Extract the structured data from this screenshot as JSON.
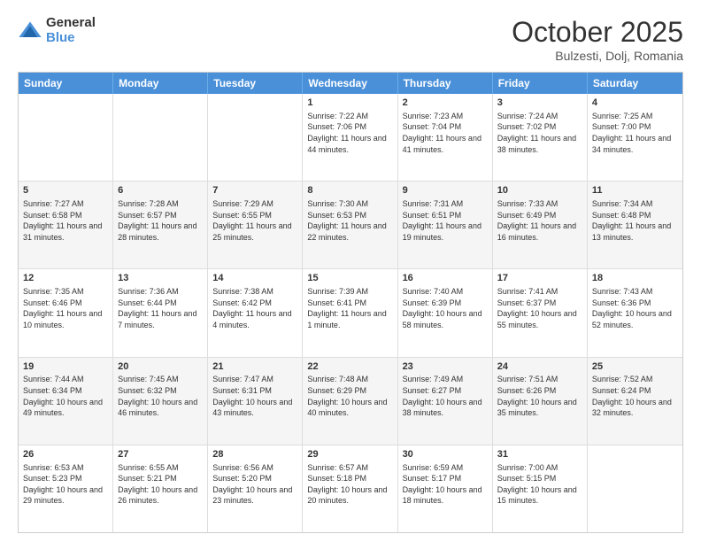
{
  "logo": {
    "general": "General",
    "blue": "Blue"
  },
  "header": {
    "month": "October 2025",
    "location": "Bulzesti, Dolj, Romania"
  },
  "weekdays": [
    "Sunday",
    "Monday",
    "Tuesday",
    "Wednesday",
    "Thursday",
    "Friday",
    "Saturday"
  ],
  "rows": [
    [
      {
        "day": "",
        "info": ""
      },
      {
        "day": "",
        "info": ""
      },
      {
        "day": "",
        "info": ""
      },
      {
        "day": "1",
        "info": "Sunrise: 7:22 AM\nSunset: 7:06 PM\nDaylight: 11 hours and 44 minutes."
      },
      {
        "day": "2",
        "info": "Sunrise: 7:23 AM\nSunset: 7:04 PM\nDaylight: 11 hours and 41 minutes."
      },
      {
        "day": "3",
        "info": "Sunrise: 7:24 AM\nSunset: 7:02 PM\nDaylight: 11 hours and 38 minutes."
      },
      {
        "day": "4",
        "info": "Sunrise: 7:25 AM\nSunset: 7:00 PM\nDaylight: 11 hours and 34 minutes."
      }
    ],
    [
      {
        "day": "5",
        "info": "Sunrise: 7:27 AM\nSunset: 6:58 PM\nDaylight: 11 hours and 31 minutes."
      },
      {
        "day": "6",
        "info": "Sunrise: 7:28 AM\nSunset: 6:57 PM\nDaylight: 11 hours and 28 minutes."
      },
      {
        "day": "7",
        "info": "Sunrise: 7:29 AM\nSunset: 6:55 PM\nDaylight: 11 hours and 25 minutes."
      },
      {
        "day": "8",
        "info": "Sunrise: 7:30 AM\nSunset: 6:53 PM\nDaylight: 11 hours and 22 minutes."
      },
      {
        "day": "9",
        "info": "Sunrise: 7:31 AM\nSunset: 6:51 PM\nDaylight: 11 hours and 19 minutes."
      },
      {
        "day": "10",
        "info": "Sunrise: 7:33 AM\nSunset: 6:49 PM\nDaylight: 11 hours and 16 minutes."
      },
      {
        "day": "11",
        "info": "Sunrise: 7:34 AM\nSunset: 6:48 PM\nDaylight: 11 hours and 13 minutes."
      }
    ],
    [
      {
        "day": "12",
        "info": "Sunrise: 7:35 AM\nSunset: 6:46 PM\nDaylight: 11 hours and 10 minutes."
      },
      {
        "day": "13",
        "info": "Sunrise: 7:36 AM\nSunset: 6:44 PM\nDaylight: 11 hours and 7 minutes."
      },
      {
        "day": "14",
        "info": "Sunrise: 7:38 AM\nSunset: 6:42 PM\nDaylight: 11 hours and 4 minutes."
      },
      {
        "day": "15",
        "info": "Sunrise: 7:39 AM\nSunset: 6:41 PM\nDaylight: 11 hours and 1 minute."
      },
      {
        "day": "16",
        "info": "Sunrise: 7:40 AM\nSunset: 6:39 PM\nDaylight: 10 hours and 58 minutes."
      },
      {
        "day": "17",
        "info": "Sunrise: 7:41 AM\nSunset: 6:37 PM\nDaylight: 10 hours and 55 minutes."
      },
      {
        "day": "18",
        "info": "Sunrise: 7:43 AM\nSunset: 6:36 PM\nDaylight: 10 hours and 52 minutes."
      }
    ],
    [
      {
        "day": "19",
        "info": "Sunrise: 7:44 AM\nSunset: 6:34 PM\nDaylight: 10 hours and 49 minutes."
      },
      {
        "day": "20",
        "info": "Sunrise: 7:45 AM\nSunset: 6:32 PM\nDaylight: 10 hours and 46 minutes."
      },
      {
        "day": "21",
        "info": "Sunrise: 7:47 AM\nSunset: 6:31 PM\nDaylight: 10 hours and 43 minutes."
      },
      {
        "day": "22",
        "info": "Sunrise: 7:48 AM\nSunset: 6:29 PM\nDaylight: 10 hours and 40 minutes."
      },
      {
        "day": "23",
        "info": "Sunrise: 7:49 AM\nSunset: 6:27 PM\nDaylight: 10 hours and 38 minutes."
      },
      {
        "day": "24",
        "info": "Sunrise: 7:51 AM\nSunset: 6:26 PM\nDaylight: 10 hours and 35 minutes."
      },
      {
        "day": "25",
        "info": "Sunrise: 7:52 AM\nSunset: 6:24 PM\nDaylight: 10 hours and 32 minutes."
      }
    ],
    [
      {
        "day": "26",
        "info": "Sunrise: 6:53 AM\nSunset: 5:23 PM\nDaylight: 10 hours and 29 minutes."
      },
      {
        "day": "27",
        "info": "Sunrise: 6:55 AM\nSunset: 5:21 PM\nDaylight: 10 hours and 26 minutes."
      },
      {
        "day": "28",
        "info": "Sunrise: 6:56 AM\nSunset: 5:20 PM\nDaylight: 10 hours and 23 minutes."
      },
      {
        "day": "29",
        "info": "Sunrise: 6:57 AM\nSunset: 5:18 PM\nDaylight: 10 hours and 20 minutes."
      },
      {
        "day": "30",
        "info": "Sunrise: 6:59 AM\nSunset: 5:17 PM\nDaylight: 10 hours and 18 minutes."
      },
      {
        "day": "31",
        "info": "Sunrise: 7:00 AM\nSunset: 5:15 PM\nDaylight: 10 hours and 15 minutes."
      },
      {
        "day": "",
        "info": ""
      }
    ]
  ]
}
